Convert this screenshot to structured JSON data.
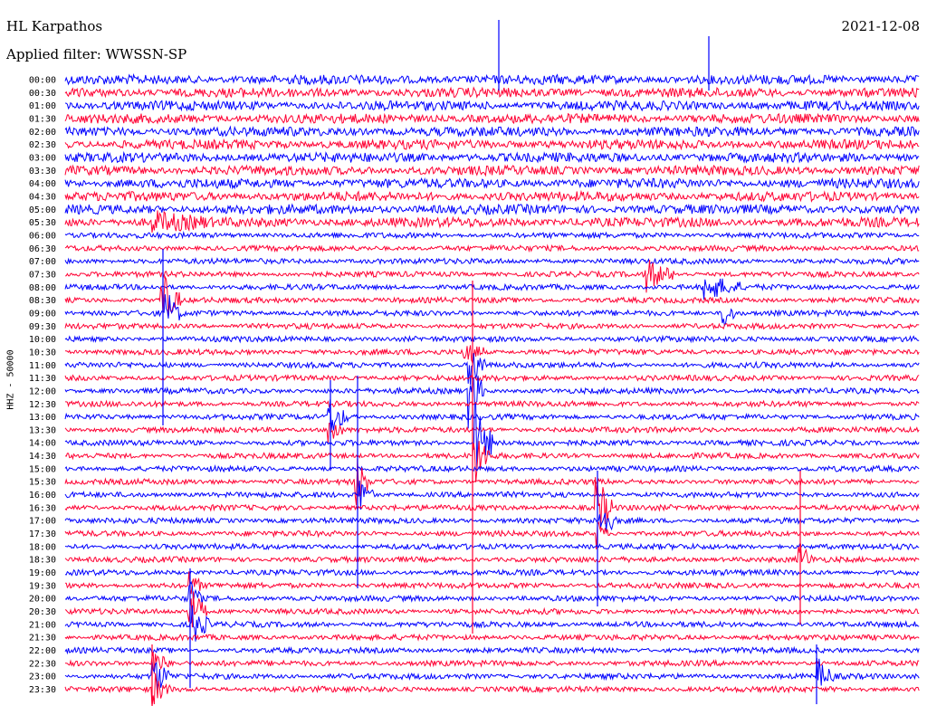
{
  "header": {
    "station": "HL Karpathos",
    "filter": "Applied filter: WWSSN-SP",
    "date": "2021-12-08"
  },
  "chart_data": {
    "type": "line",
    "ylabel": "HHZ - 50000",
    "colors": [
      "#0000ff",
      "#ff0033"
    ],
    "times": [
      "00:00",
      "00:30",
      "01:00",
      "01:30",
      "02:00",
      "02:30",
      "03:00",
      "03:30",
      "04:00",
      "04:30",
      "05:00",
      "05:30",
      "06:00",
      "06:30",
      "07:00",
      "07:30",
      "08:00",
      "08:30",
      "09:00",
      "09:30",
      "10:00",
      "10:30",
      "11:00",
      "11:30",
      "12:00",
      "12:30",
      "13:00",
      "13:30",
      "14:00",
      "14:30",
      "15:00",
      "15:30",
      "16:00",
      "16:30",
      "17:00",
      "17:30",
      "18:00",
      "18:30",
      "19:00",
      "19:30",
      "20:00",
      "20:30",
      "21:00",
      "21:30",
      "22:00",
      "22:30",
      "23:00",
      "23:30"
    ]
  }
}
